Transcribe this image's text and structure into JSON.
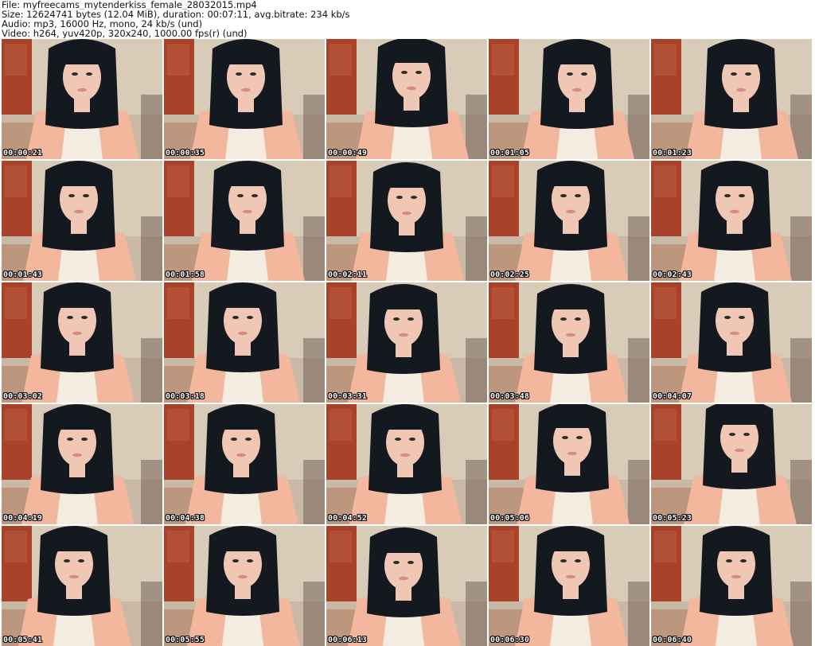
{
  "header": {
    "file_line": "File: myfreecams_mytenderkiss_female_28032015.mp4",
    "size_line": "Size: 12624741 bytes (12.04 MiB), duration: 00:07:11, avg.bitrate: 234 kb/s",
    "audio_line": "Audio: mp3, 16000 Hz, mono, 24 kb/s (und)",
    "video_line": "Video: h264, yuv420p, 320x240, 1000.00 fps(r) (und)"
  },
  "colors": {
    "wall": "#d8cbb8",
    "door": "#a8432a",
    "hair": "#14181f",
    "skin": "#f0c6b4",
    "cardigan": "#f2b79c",
    "top": "#f4ece0"
  },
  "thumbnails": [
    {
      "timestamp": "00:00:21"
    },
    {
      "timestamp": "00:00:35"
    },
    {
      "timestamp": "00:00:49"
    },
    {
      "timestamp": "00:01:05"
    },
    {
      "timestamp": "00:01:23"
    },
    {
      "timestamp": "00:01:43"
    },
    {
      "timestamp": "00:01:58"
    },
    {
      "timestamp": "00:02:11"
    },
    {
      "timestamp": "00:02:25"
    },
    {
      "timestamp": "00:02:43"
    },
    {
      "timestamp": "00:03:02"
    },
    {
      "timestamp": "00:03:18"
    },
    {
      "timestamp": "00:03:31"
    },
    {
      "timestamp": "00:03:48"
    },
    {
      "timestamp": "00:04:07"
    },
    {
      "timestamp": "00:04:19"
    },
    {
      "timestamp": "00:04:38"
    },
    {
      "timestamp": "00:04:52"
    },
    {
      "timestamp": "00:05:06"
    },
    {
      "timestamp": "00:05:23"
    },
    {
      "timestamp": "00:05:41"
    },
    {
      "timestamp": "00:05:55"
    },
    {
      "timestamp": "00:06:13"
    },
    {
      "timestamp": "00:06:30"
    },
    {
      "timestamp": "00:06:40"
    }
  ]
}
